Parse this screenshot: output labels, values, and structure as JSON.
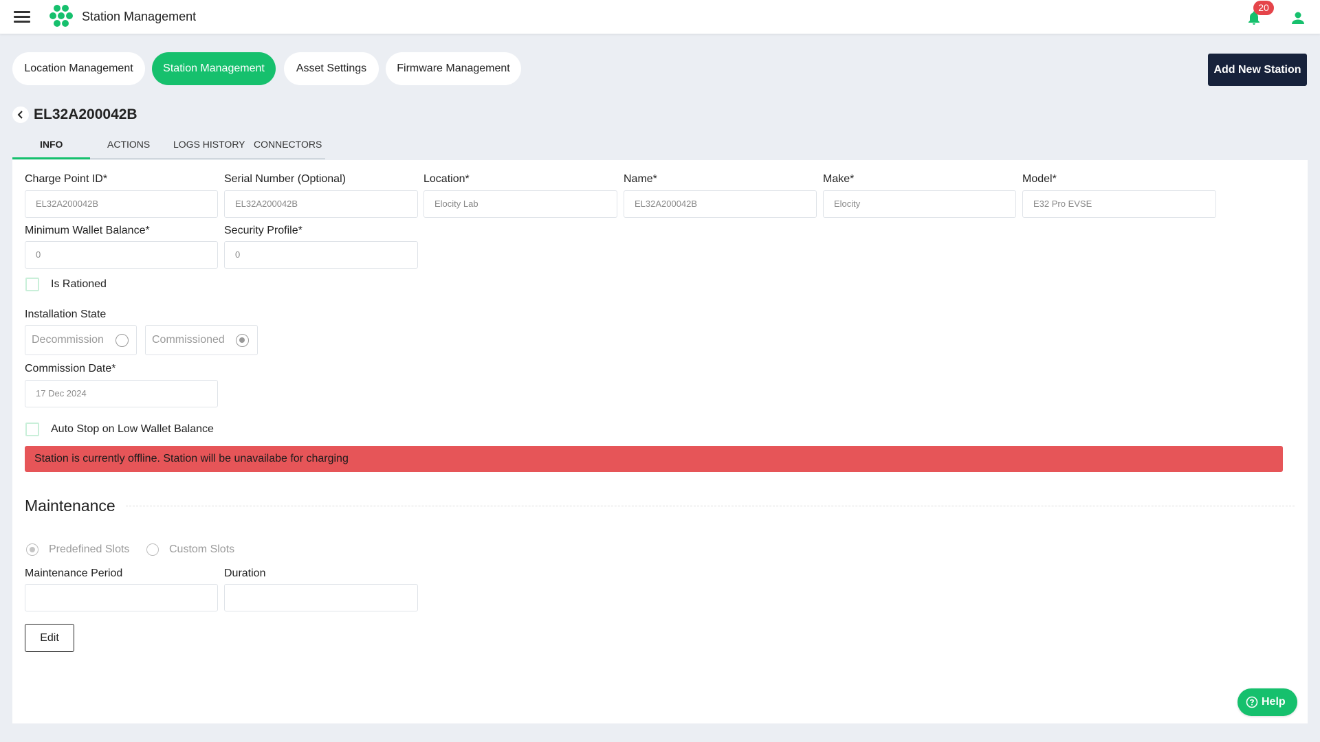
{
  "app": {
    "title": "Station Management",
    "notification_count": "20",
    "accent": "#16c06d",
    "dark": "#17223b"
  },
  "nav": {
    "tabs": [
      {
        "label": "Location Management",
        "active": false
      },
      {
        "label": "Station Management",
        "active": true
      },
      {
        "label": "Asset Settings",
        "active": false
      },
      {
        "label": "Firmware Management",
        "active": false
      }
    ],
    "add_button": "Add New Station"
  },
  "station": {
    "title": "EL32A200042B",
    "subtabs": [
      "INFO",
      "ACTIONS",
      "LOGS HISTORY",
      "CONNECTORS"
    ],
    "active_subtab": "INFO"
  },
  "form": {
    "charge_point_id": {
      "label": "Charge Point ID*",
      "value": "EL32A200042B"
    },
    "serial_number": {
      "label": "Serial Number (Optional)",
      "value": "EL32A200042B"
    },
    "location": {
      "label": "Location*",
      "value": "Elocity Lab"
    },
    "name": {
      "label": "Name*",
      "value": "EL32A200042B"
    },
    "make": {
      "label": "Make*",
      "value": "Elocity"
    },
    "model": {
      "label": "Model*",
      "value": "E32 Pro EVSE"
    },
    "min_wallet_balance": {
      "label": "Minimum Wallet Balance*",
      "value": "0"
    },
    "security_profile": {
      "label": "Security Profile*",
      "value": "0"
    },
    "is_rationed": {
      "label": "Is Rationed",
      "checked": false
    },
    "installation_state": {
      "label": "Installation State",
      "options": [
        {
          "label": "Decommission",
          "selected": false
        },
        {
          "label": "Commissioned",
          "selected": true
        }
      ]
    },
    "commission_date": {
      "label": "Commission Date*",
      "value": "17 Dec 2024"
    },
    "auto_stop": {
      "label": "Auto Stop on Low Wallet Balance",
      "checked": false
    },
    "offline_alert": "Station is currently offline. Station will be unavailabe for charging",
    "alert_color": "#e65558"
  },
  "maintenance": {
    "title": "Maintenance",
    "slot_options": [
      {
        "label": "Predefined Slots",
        "selected": true
      },
      {
        "label": "Custom Slots",
        "selected": false
      }
    ],
    "period": {
      "label": "Maintenance Period",
      "value": ""
    },
    "duration": {
      "label": "Duration",
      "value": ""
    },
    "edit_button": "Edit"
  },
  "help": {
    "label": "Help"
  }
}
